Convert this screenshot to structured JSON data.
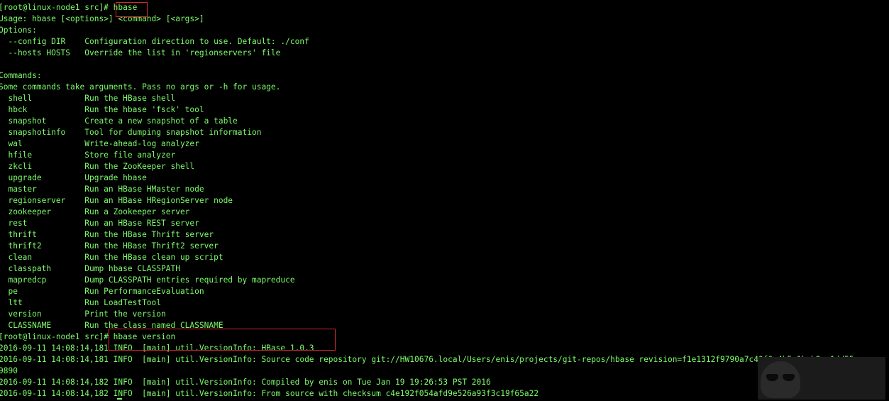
{
  "terminal": {
    "lines": [
      "[root@linux-node1 src]# hbase",
      "Usage: hbase [<options>] <command> [<args>]",
      "Options:",
      "  --config DIR    Configuration direction to use. Default: ./conf",
      "  --hosts HOSTS   Override the list in 'regionservers' file",
      "",
      "Commands:",
      "Some commands take arguments. Pass no args or -h for usage.",
      "  shell           Run the HBase shell",
      "  hbck            Run the hbase 'fsck' tool",
      "  snapshot        Create a new snapshot of a table",
      "  snapshotinfo    Tool for dumping snapshot information",
      "  wal             Write-ahead-log analyzer",
      "  hfile           Store file analyzer",
      "  zkcli           Run the ZooKeeper shell",
      "  upgrade         Upgrade hbase",
      "  master          Run an HBase HMaster node",
      "  regionserver    Run an HBase HRegionServer node",
      "  zookeeper       Run a Zookeeper server",
      "  rest            Run an HBase REST server",
      "  thrift          Run the HBase Thrift server",
      "  thrift2         Run the HBase Thrift2 server",
      "  clean           Run the HBase clean up script",
      "  classpath       Dump hbase CLASSPATH",
      "  mapredcp        Dump CLASSPATH entries required by mapreduce",
      "  pe              Run PerformanceEvaluation",
      "  ltt             Run LoadTestTool",
      "  version         Print the version",
      "  CLASSNAME       Run the class named CLASSNAME",
      "[root@linux-node1 src]# hbase version",
      "2016-09-11 14:08:14,181 INFO  [main] util.VersionInfo: HBase 1.0.3",
      "2016-09-11 14:08:14,181 INFO  [main] util.VersionInfo: Source code repository git://HW10676.local/Users/enis/projects/git-repos/hbase revision=f1e1312f9790a7c40f6a4b5a1bab2ea1dd55",
      "9890",
      "2016-09-11 14:08:14,182 INFO  [main] util.VersionInfo: Compiled by enis on Tue Jan 19 19:26:53 PST 2016",
      "2016-09-11 14:08:14,182 INFO  [main] util.VersionInfo: From source with checksum c4e192f054afd9e526a93f3c19f65a22"
    ]
  },
  "colors": {
    "background": "#000000",
    "text": "#7CFC6A",
    "highlight_box": "#d32a2a"
  },
  "icons": [
    "cursor-icon",
    "avatar-icon"
  ]
}
